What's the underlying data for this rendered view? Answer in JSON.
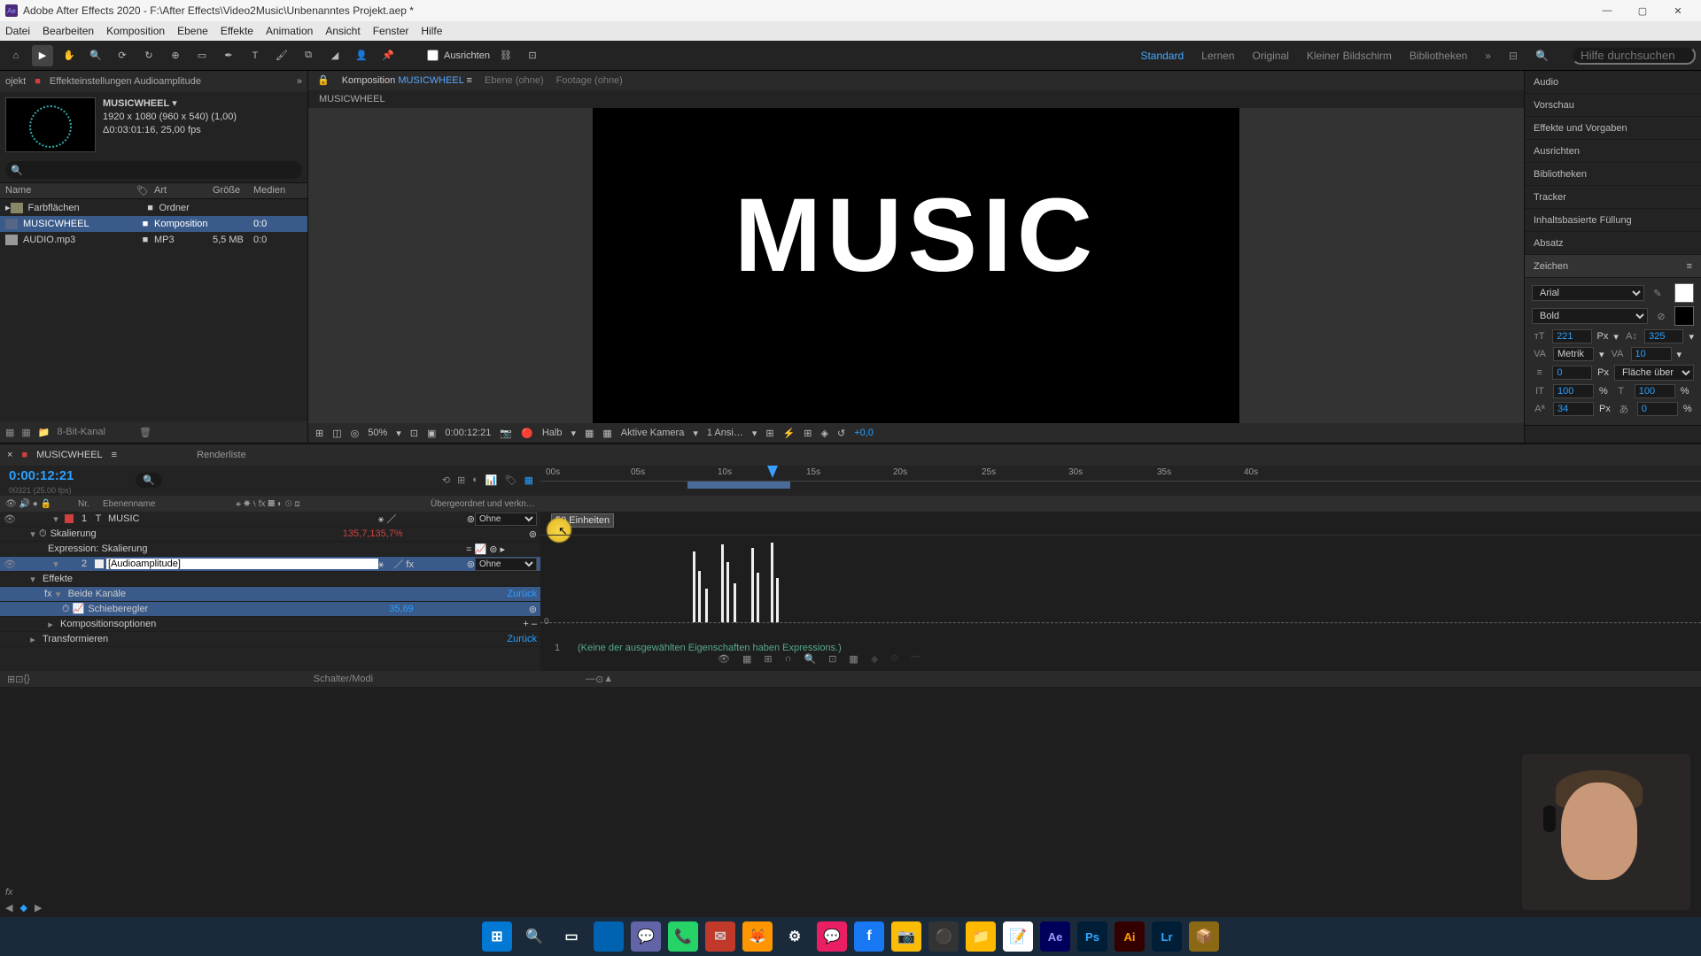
{
  "titlebar": {
    "app": "Adobe After Effects 2020",
    "path": "F:\\After Effects\\Video2Music\\Unbenanntes Projekt.aep *"
  },
  "menu": [
    "Datei",
    "Bearbeiten",
    "Komposition",
    "Ebene",
    "Effekte",
    "Animation",
    "Ansicht",
    "Fenster",
    "Hilfe"
  ],
  "toolbar": {
    "align_label": "Ausrichten",
    "workspaces": [
      "Standard",
      "Lernen",
      "Original",
      "Kleiner Bildschirm",
      "Bibliotheken"
    ],
    "active_workspace": "Standard",
    "search_placeholder": "Hilfe durchsuchen"
  },
  "project": {
    "tab_project": "ojekt",
    "tab_effects": "Effekteinstellungen Audioamplitude",
    "comp_name": "MUSICWHEEL",
    "dims": "1920 x 1080 (960 x 540) (1,00)",
    "duration": "Δ0:03:01:16, 25,00 fps",
    "cols": {
      "name": "Name",
      "art": "Art",
      "size": "Größe",
      "media": "Medien"
    },
    "items": [
      {
        "name": "Farbflächen",
        "art": "Ordner",
        "size": "",
        "media": ""
      },
      {
        "name": "MUSICWHEEL",
        "art": "Komposition",
        "size": "",
        "media": "0:0"
      },
      {
        "name": "AUDIO.mp3",
        "art": "MP3",
        "size": "5,5 MB",
        "media": "0:0"
      }
    ],
    "footer_depth": "8-Bit-Kanal"
  },
  "viewer": {
    "tab_comp_prefix": "Komposition",
    "tab_comp_name": "MUSICWHEEL",
    "tab_layer": "Ebene (ohne)",
    "tab_footage": "Footage (ohne)",
    "crumb": "MUSICWHEEL",
    "canvas_text": "MUSIC",
    "footer": {
      "zoom": "50%",
      "time": "0:00:12:21",
      "res": "Halb",
      "camera": "Aktive Kamera",
      "views": "1 Ansi…",
      "exposure": "+0,0"
    }
  },
  "right": {
    "panels": [
      "Audio",
      "Vorschau",
      "Effekte und Vorgaben",
      "Ausrichten",
      "Bibliotheken",
      "Tracker",
      "Inhaltsbasierte Füllung",
      "Absatz"
    ],
    "char_title": "Zeichen",
    "font": "Arial",
    "weight": "Bold",
    "size": "221",
    "size_unit": "Px",
    "leading": "325",
    "kerning": "Metrik",
    "tracking": "10",
    "stroke": "0",
    "stroke_unit": "Px",
    "stroke_mode": "Fläche über Kon…",
    "vscale": "100",
    "hscale": "100",
    "baseline": "34",
    "tsume": "0"
  },
  "timeline": {
    "tab": "MUSICWHEEL",
    "render": "Renderliste",
    "time": "0:00:12:21",
    "time_sub": "00321 (25.00 fps)",
    "cols": {
      "nr": "Nr.",
      "layer": "Ebenenname",
      "parent": "Übergeordnet und verkn…"
    },
    "ruler": [
      "00s",
      "05s",
      "10s",
      "15s",
      "20s",
      "25s",
      "30s",
      "35s",
      "40s"
    ],
    "layers": {
      "l1_num": "1",
      "l1_name": "MUSIC",
      "l1_parent": "Ohne",
      "l1_scale_label": "Skalierung",
      "l1_scale_val": "135,7,135,7%",
      "l1_expr": "Expression: Skalierung",
      "l2_num": "2",
      "l2_name": "[Audioamplitude]",
      "l2_parent": "Ohne",
      "l2_fx": "Effekte",
      "l2_both": "Beide Kanäle",
      "l2_both_val": "Zurück",
      "l2_slider": "Schieberegler",
      "l2_slider_val": "35,69",
      "l2_compopt": "Kompositionsoptionen",
      "l2_compopt_val": "+ –",
      "l2_transform": "Transformieren",
      "l2_transform_val": "Zurück"
    },
    "tooltip": "50 Einheiten",
    "expr_num": "1",
    "expr_text": "(Keine der ausgewählten Eigenschaften haben Expressions.)",
    "footer": "Schalter/Modi"
  },
  "taskbar_icons": [
    "⊞",
    "🔍",
    "▭",
    "▬",
    "💬",
    "📞",
    "✉",
    "🦊",
    "⚙",
    "💬",
    "f",
    "📷",
    "⚫",
    "📁",
    "📝",
    "Ae",
    "Ps",
    "Ai",
    "Lr",
    "📦"
  ],
  "colors": {
    "accent": "#2aa0ff",
    "link": "#58a6ff",
    "red": "#d04040",
    "selection": "#3a5a8a"
  }
}
